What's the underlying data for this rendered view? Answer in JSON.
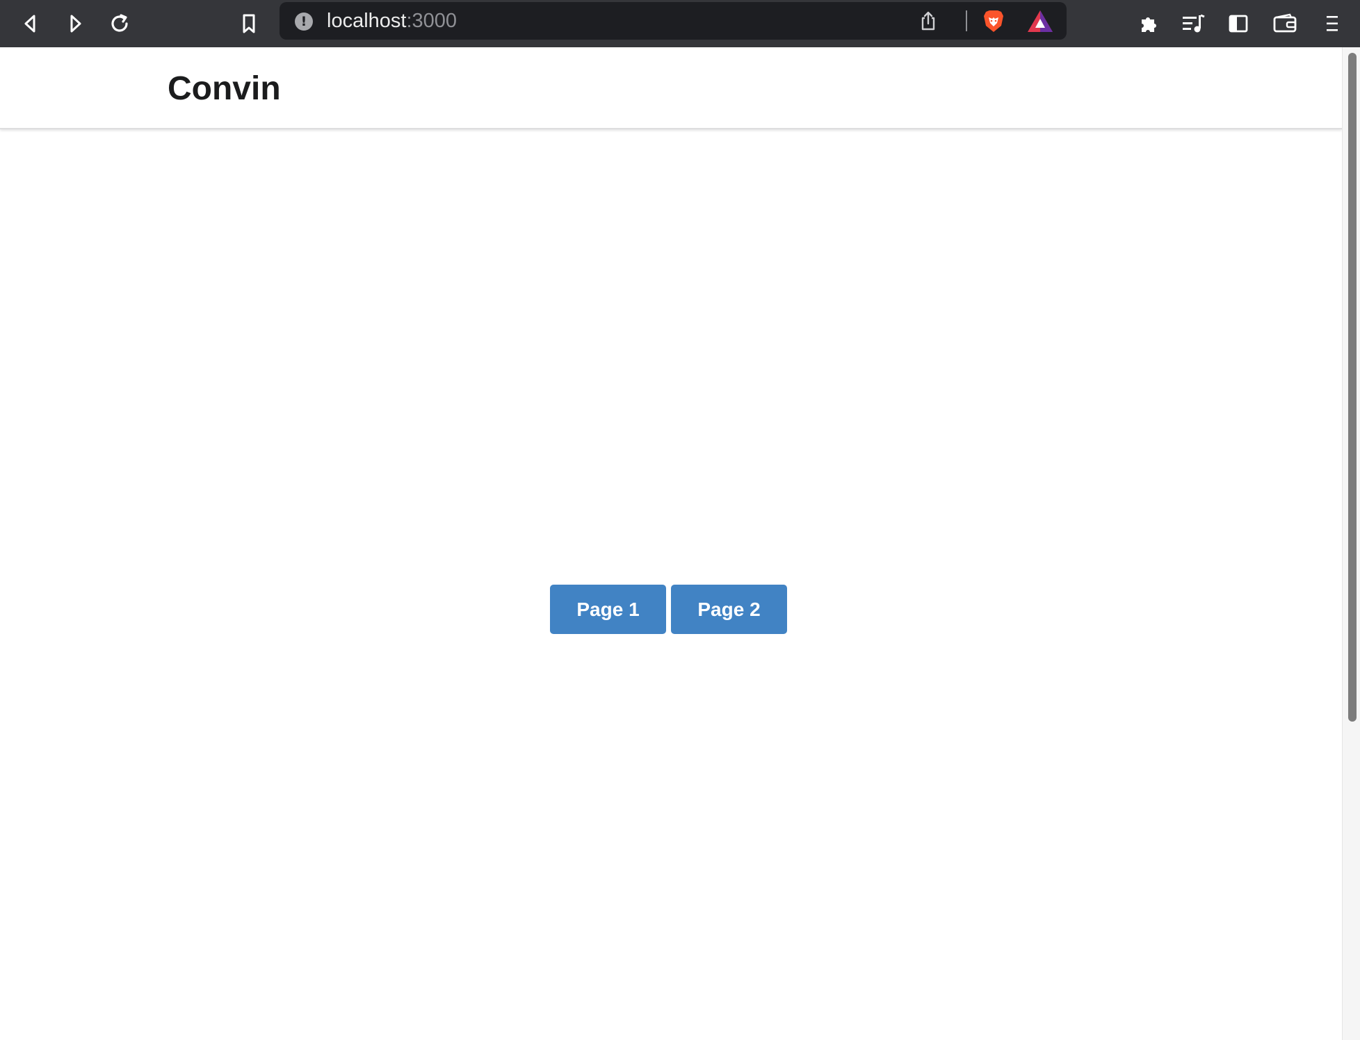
{
  "browser": {
    "url_host": "localhost",
    "url_port": ":3000",
    "icons": {
      "back": "back-arrow-icon",
      "forward": "forward-arrow-icon",
      "reload": "reload-icon",
      "bookmark": "bookmark-icon",
      "site_info": "site-info-icon",
      "share": "share-icon",
      "brave_shields": "brave-shields-icon",
      "brave_rewards": "brave-rewards-icon",
      "extensions": "extensions-puzzle-icon",
      "reading_list": "reading-list-icon",
      "sidebar": "sidebar-icon",
      "wallet": "wallet-icon",
      "menu": "menu-icon"
    },
    "site_info_glyph": "!"
  },
  "page": {
    "brand": "Convin",
    "buttons": [
      {
        "label": "Page 1"
      },
      {
        "label": "Page 2"
      }
    ]
  },
  "colors": {
    "toolbar_bg": "#35363a",
    "urlbar_bg": "#1d1e22",
    "button_bg": "#4183c4",
    "button_text": "#ffffff",
    "brand_text": "#1b1c1d",
    "brave_orange": "#fb542b"
  }
}
